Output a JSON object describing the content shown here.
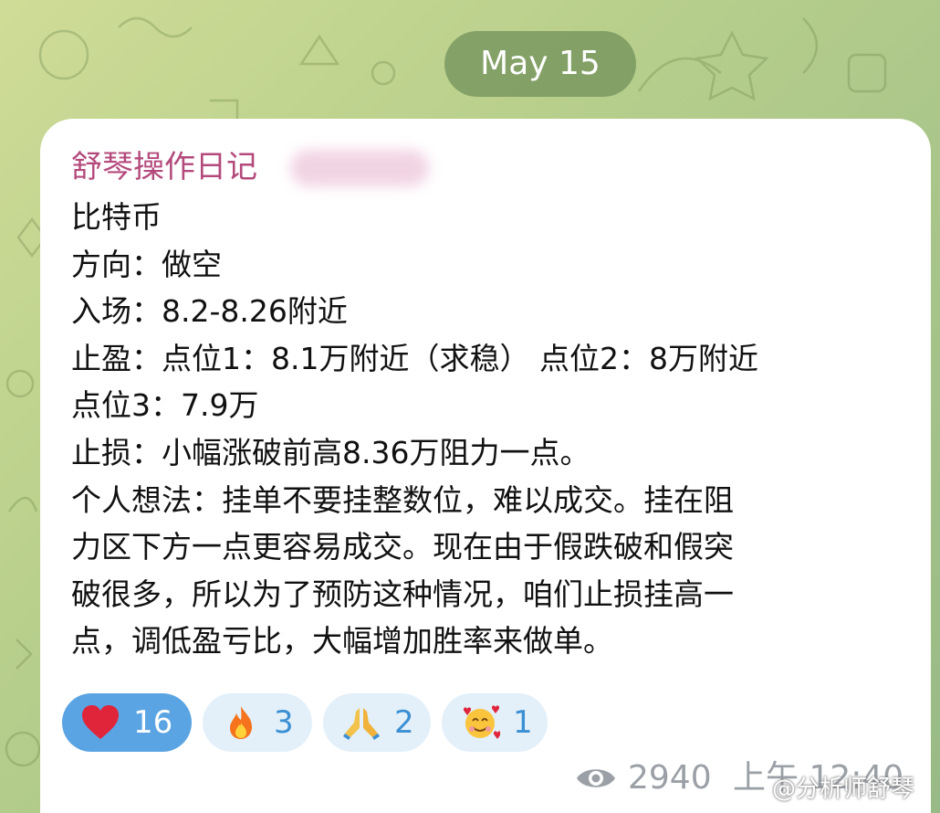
{
  "chat": {
    "date_separator": "May 15"
  },
  "message": {
    "sender": "舒琴操作日记",
    "lines": [
      "比特币",
      "方向：做空",
      "入场：8.2-8.26附近",
      "止盈：点位1：8.1万附近（求稳） 点位2：8万附近",
      "点位3：7.9万",
      "止损：小幅涨破前高8.36万阻力一点。",
      "个人想法：挂单不要挂整数位，难以成交。挂在阻",
      "力区下方一点更容易成交。现在由于假跌破和假突",
      "破很多，所以为了预防这种情况，咱们止损挂高一",
      "点，调低盈亏比，大幅增加胜率来做单。"
    ],
    "reactions": [
      {
        "emoji": "red-heart-icon",
        "count": "16",
        "selected": true
      },
      {
        "emoji": "fire-icon",
        "count": "3",
        "selected": false
      },
      {
        "emoji": "folded-hands-icon",
        "count": "2",
        "selected": false
      },
      {
        "emoji": "smiling-face-with-hearts-icon",
        "count": "1",
        "selected": false
      }
    ],
    "views": "2940",
    "time": "上午 12:40"
  },
  "watermark": "@分析师舒琴",
  "colors": {
    "sender": "#b44a7c",
    "reaction_active_bg": "#5aa4e3",
    "reaction_bg": "#e3f0fa",
    "reaction_text": "#3b8fd3",
    "meta_text": "#9aa0a6",
    "date_pill_bg": "#7f9a63"
  }
}
